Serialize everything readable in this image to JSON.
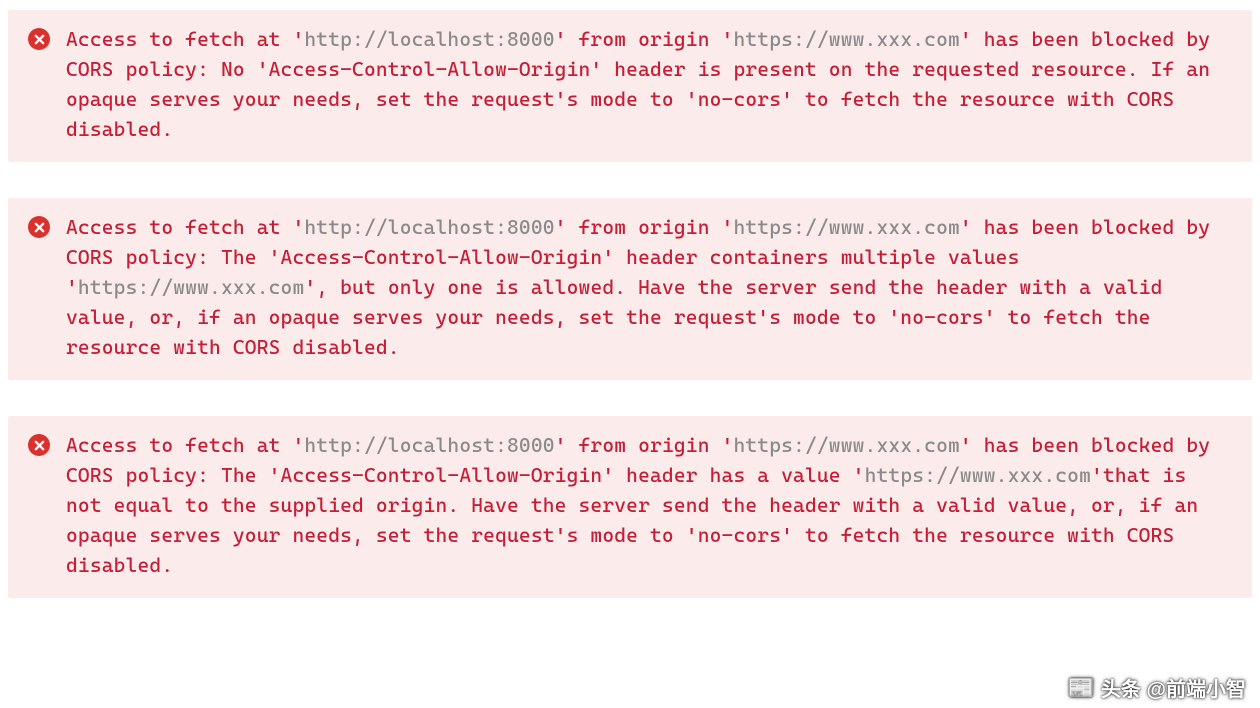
{
  "errors": [
    {
      "segments": [
        {
          "t": "Access to fetch at '",
          "grey": false
        },
        {
          "t": "http://localhost:8000",
          "grey": true
        },
        {
          "t": "' from origin '",
          "grey": false
        },
        {
          "t": "https://www.xxx.com",
          "grey": true
        },
        {
          "t": "' has been blocked by CORS policy: No 'Access-Control-Allow-Origin' header is present on the requested resource. If an opaque serves your needs, set the request's mode to 'no-cors' to fetch the resource with CORS disabled.",
          "grey": false
        }
      ]
    },
    {
      "segments": [
        {
          "t": "Access to fetch at '",
          "grey": false
        },
        {
          "t": "http://localhost:8000",
          "grey": true
        },
        {
          "t": "' from origin '",
          "grey": false
        },
        {
          "t": "https://www.xxx.com",
          "grey": true
        },
        {
          "t": "' has been blocked by CORS policy: The 'Access-Control-Allow-Origin' header containers multiple values '",
          "grey": false
        },
        {
          "t": "https://www.xxx.com",
          "grey": true
        },
        {
          "t": "', but only one is allowed. Have the server send the header with a valid value, or, if an opaque serves your needs, set the request's mode to 'no-cors' to fetch the resource with CORS disabled.",
          "grey": false
        }
      ]
    },
    {
      "segments": [
        {
          "t": "Access to fetch at '",
          "grey": false
        },
        {
          "t": "http://localhost:8000",
          "grey": true
        },
        {
          "t": "' from origin '",
          "grey": false
        },
        {
          "t": "https://www.xxx.com",
          "grey": true
        },
        {
          "t": "' has been blocked by CORS policy: The 'Access-Control-Allow-Origin' header has a value '",
          "grey": false
        },
        {
          "t": "https://www.xxx.com",
          "grey": true
        },
        {
          "t": "'that is not equal to the supplied origin. Have the server send the header with a valid value, or, if an opaque serves your needs, set the request's mode to 'no-cors' to fetch the resource with CORS disabled.",
          "grey": false
        }
      ]
    }
  ],
  "watermark": {
    "text": "头条 @前端小智"
  }
}
